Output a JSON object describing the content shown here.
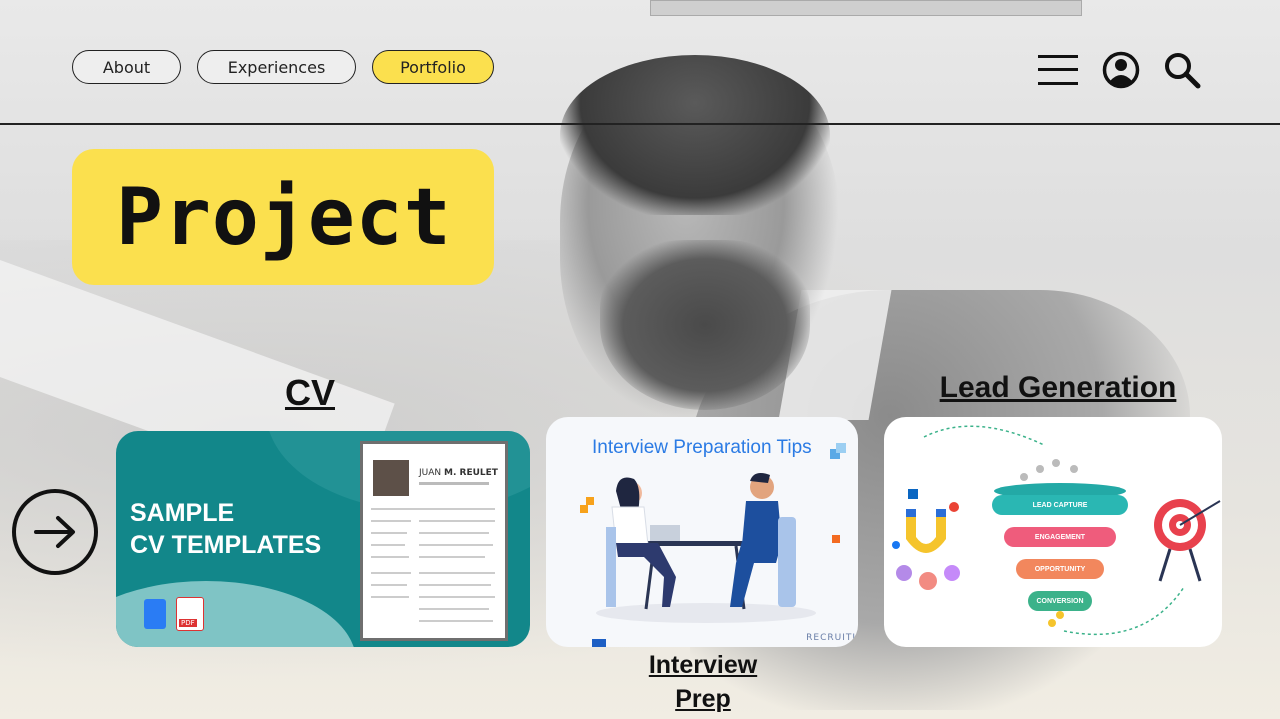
{
  "nav": {
    "items": [
      {
        "label": "About",
        "active": false
      },
      {
        "label": "Experiences",
        "active": false
      },
      {
        "label": "Portfolio",
        "active": true
      }
    ]
  },
  "header_icons": [
    "menu-icon",
    "account-icon",
    "search-icon"
  ],
  "page_title": "Project",
  "sections": {
    "cv": {
      "label": "CV",
      "card": {
        "headline_line1": "SAMPLE",
        "headline_line2": "CV TEMPLATES",
        "doc_name_light": "JUAN",
        "doc_name_bold": "M. REULET"
      }
    },
    "interview": {
      "label_line1": "Interview",
      "label_line2": "Prep",
      "card": {
        "title": "Interview Preparation Tips",
        "brand": "RECRUITI"
      }
    },
    "lead": {
      "label": "Lead Generation",
      "card": {
        "stages": [
          "LEAD CAPTURE",
          "ENGAGEMENT",
          "OPPORTUNITY",
          "CONVERSION"
        ]
      }
    }
  },
  "colors": {
    "accent": "#fbe04e",
    "cv_teal": "#12878a",
    "interview_blue": "#2b7be4",
    "stage_colors": [
      "#2ab7b3",
      "#ef5c7c",
      "#f2875d",
      "#3bb28a"
    ]
  }
}
